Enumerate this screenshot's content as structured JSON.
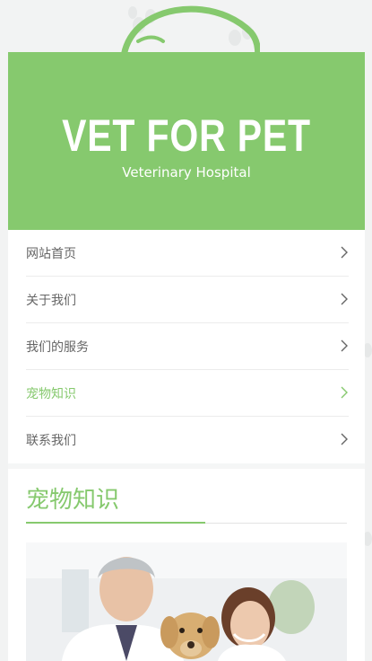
{
  "brand": {
    "title": "VET FOR PET",
    "subtitle": "Veterinary Hospital",
    "accent_color": "#86c96e"
  },
  "menu": {
    "items": [
      {
        "label": "网站首页",
        "active": false,
        "icon": "chevron-right-icon"
      },
      {
        "label": "关于我们",
        "active": false,
        "icon": "chevron-right-icon"
      },
      {
        "label": "我们的服务",
        "active": false,
        "icon": "chevron-right-icon"
      },
      {
        "label": "宠物知识",
        "active": true,
        "icon": "chevron-right-icon"
      },
      {
        "label": "联系我们",
        "active": false,
        "icon": "chevron-right-icon"
      }
    ]
  },
  "section": {
    "title": "宠物知识"
  },
  "photo": {
    "icon": "vet-with-dog-photo"
  }
}
